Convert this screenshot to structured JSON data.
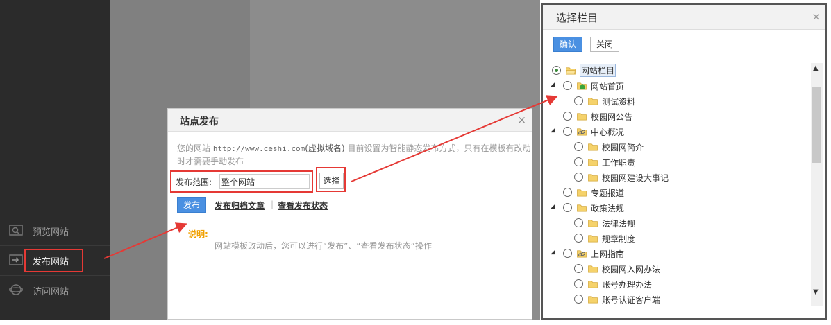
{
  "sidebar": {
    "items": [
      {
        "label": "预览网站",
        "icon": "preview-icon"
      },
      {
        "label": "发布网站",
        "icon": "publish-icon"
      },
      {
        "label": "访问网站",
        "icon": "globe-icon"
      }
    ]
  },
  "publish_dialog": {
    "title": "站点发布",
    "close": "×",
    "desc_prefix": "您的网站 ",
    "url": "http://www.ceshi.com",
    "virtual_domain": "(虚拟域名)",
    "desc_suffix": " 目前设置为智能静态发布方式，只有在模板有改动时才需要手动发布",
    "scope_label": "发布范围:",
    "scope_value": "整个网站",
    "pick_button": "选择",
    "publish_button": "发布",
    "archive_link": "发布归档文章",
    "separator": "|",
    "status_link": "查看发布状态",
    "note_title": "说明:",
    "note_text": "网站模板改动后，您可以进行“发布”、“查看发布状态”操作"
  },
  "column_dialog": {
    "title": "选择栏目",
    "close": "×",
    "ok_button": "确认",
    "close_button": "关闭",
    "tree": [
      {
        "label": "网站栏目",
        "level": 0,
        "checked": true,
        "toggle": "",
        "icon": "open-folder-icon",
        "selected": true
      },
      {
        "label": "网站首页",
        "level": 1,
        "checked": false,
        "toggle": "◢",
        "icon": "home-icon"
      },
      {
        "label": "测试资料",
        "level": 2,
        "checked": false,
        "toggle": "",
        "icon": "folder-icon"
      },
      {
        "label": "校园网公告",
        "level": 1,
        "checked": false,
        "toggle": "",
        "icon": "folder-icon"
      },
      {
        "label": "中心概况",
        "level": 1,
        "checked": false,
        "toggle": "◢",
        "icon": "link-folder-icon"
      },
      {
        "label": "校园网简介",
        "level": 2,
        "checked": false,
        "toggle": "",
        "icon": "folder-icon"
      },
      {
        "label": "工作职责",
        "level": 2,
        "checked": false,
        "toggle": "",
        "icon": "folder-icon"
      },
      {
        "label": "校园网建设大事记",
        "level": 2,
        "checked": false,
        "toggle": "",
        "icon": "folder-icon"
      },
      {
        "label": "专题报道",
        "level": 1,
        "checked": false,
        "toggle": "",
        "icon": "folder-icon"
      },
      {
        "label": "政策法规",
        "level": 1,
        "checked": false,
        "toggle": "◢",
        "icon": "folder-icon"
      },
      {
        "label": "法律法规",
        "level": 2,
        "checked": false,
        "toggle": "",
        "icon": "folder-icon"
      },
      {
        "label": "规章制度",
        "level": 2,
        "checked": false,
        "toggle": "",
        "icon": "folder-icon"
      },
      {
        "label": "上网指南",
        "level": 1,
        "checked": false,
        "toggle": "◢",
        "icon": "link-folder-icon"
      },
      {
        "label": "校园网入网办法",
        "level": 2,
        "checked": false,
        "toggle": "",
        "icon": "folder-icon"
      },
      {
        "label": "账号办理办法",
        "level": 2,
        "checked": false,
        "toggle": "",
        "icon": "folder-icon"
      },
      {
        "label": "账号认证客户端",
        "level": 2,
        "checked": false,
        "toggle": "",
        "icon": "folder-icon"
      }
    ]
  },
  "colors": {
    "accent": "#4a90e2",
    "highlight": "#e53935",
    "note": "#f0a000",
    "sidebar_bg": "#2b2b2b",
    "overlay": "#808080"
  }
}
